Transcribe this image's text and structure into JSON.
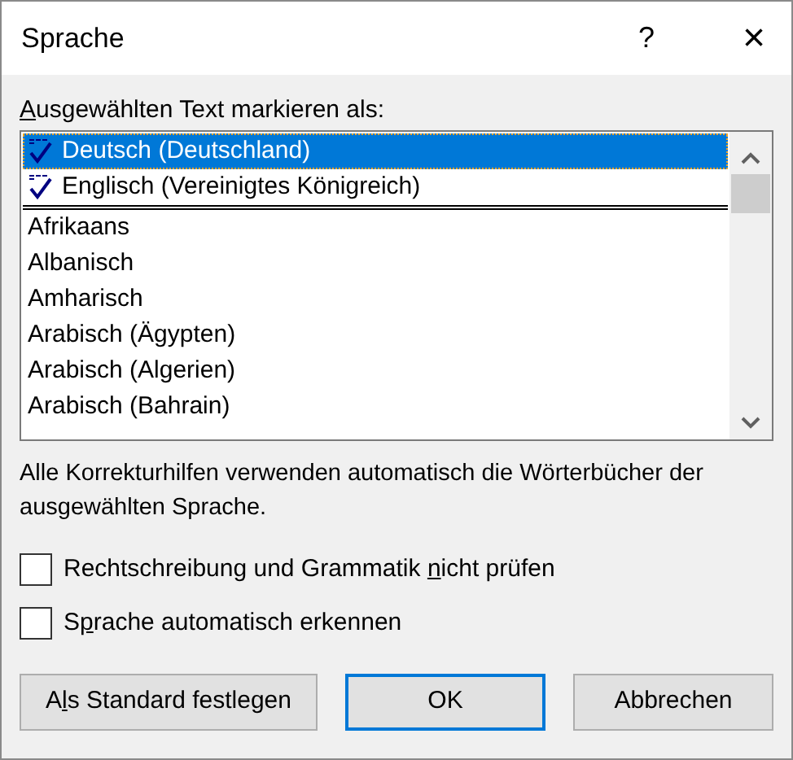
{
  "window": {
    "title": "Sprache",
    "help": "?",
    "close": "×"
  },
  "list_label": {
    "key": "A",
    "post": "usgewählten Text markieren als:"
  },
  "languages": [
    {
      "label": "Deutsch (Deutschland)",
      "kind": "recent",
      "selected": true
    },
    {
      "label": "Englisch (Vereinigtes Königreich)",
      "kind": "recent",
      "selected": false
    },
    {
      "label": "Afrikaans",
      "kind": "language",
      "selected": false
    },
    {
      "label": "Albanisch",
      "kind": "language",
      "selected": false
    },
    {
      "label": "Amharisch",
      "kind": "language",
      "selected": false
    },
    {
      "label": "Arabisch (Ägypten)",
      "kind": "language",
      "selected": false
    },
    {
      "label": "Arabisch (Algerien)",
      "kind": "language",
      "selected": false
    },
    {
      "label": "Arabisch (Bahrain)",
      "kind": "language",
      "selected": false
    }
  ],
  "info": "Alle Korrekturhilfen verwenden automatisch die Wörterbücher der ausgewählten Sprache.",
  "checkboxes": [
    {
      "pre": "Rechtschreibung und Grammatik ",
      "key": "n",
      "post": "icht prüfen",
      "checked": false
    },
    {
      "pre": "S",
      "key": "p",
      "post": "rache automatisch erkennen",
      "checked": false
    }
  ],
  "buttons": [
    {
      "pre": "A",
      "key": "l",
      "post": "s Standard festlegen",
      "default": false
    },
    {
      "pre": "OK",
      "default": true
    },
    {
      "pre": "Abbrechen",
      "default": false
    }
  ]
}
